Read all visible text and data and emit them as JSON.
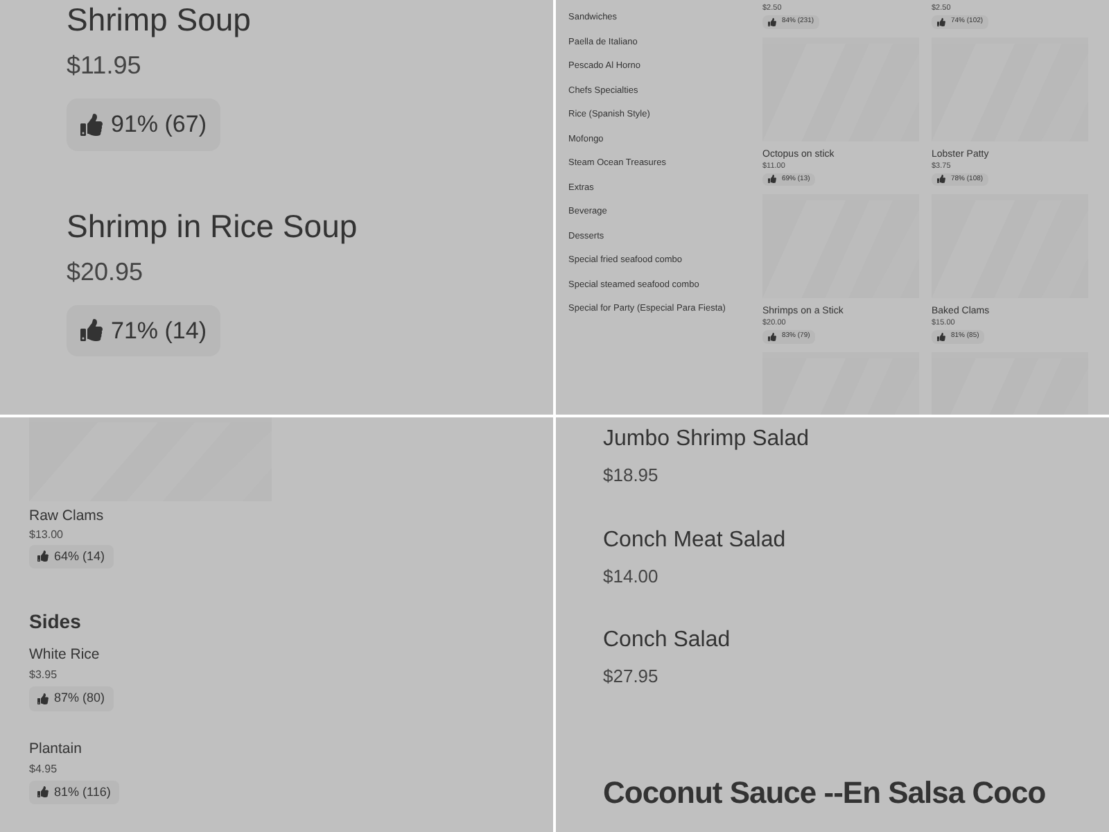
{
  "top_left": {
    "items": [
      {
        "name": "Shrimp Soup",
        "price": "$11.95",
        "rating": "91% (67)"
      },
      {
        "name": "Shrimp in Rice Soup",
        "price": "$20.95",
        "rating": "71% (14)"
      }
    ]
  },
  "top_right": {
    "categories": [
      "Sandwiches",
      "Paella de Italiano",
      "Pescado Al Horno",
      "Chefs Specialties",
      "Rice (Spanish Style)",
      "Mofongo",
      "Steam Ocean Treasures",
      "Extras",
      "Beverage",
      "Desserts",
      "Special fried seafood combo",
      "Special steamed seafood combo",
      "Special for Party (Especial Para Fiesta)"
    ],
    "cards": [
      {
        "price": "$2.50",
        "rating": "84% (231)"
      },
      {
        "price": "$2.50",
        "rating": "74% (102)"
      },
      {
        "kind": "picture",
        "name": "Octopus on stick",
        "price": "$11.00",
        "rating": "69% (13)"
      },
      {
        "kind": "picture",
        "name": "Lobster Patty",
        "price": "$3.75",
        "rating": "78% (108)"
      },
      {
        "kind": "picture",
        "name": "Shrimps on a Stick",
        "price": "$20.00",
        "rating": "83% (79)"
      },
      {
        "kind": "picture",
        "name": "Baked Clams",
        "price": "$15.00",
        "rating": "81% (85)"
      },
      {
        "kind": "picture"
      },
      {
        "kind": "picture"
      }
    ]
  },
  "bottom_left": {
    "first": {
      "kind": "picture",
      "name": "Raw Clams",
      "price": "$13.00",
      "rating": "64% (14)"
    },
    "section": "Sides",
    "items": [
      {
        "name": "White Rice",
        "price": "$3.95",
        "rating": "87% (80)"
      },
      {
        "name": "Plantain",
        "price": "$4.95",
        "rating": "81% (116)"
      }
    ]
  },
  "bottom_right": {
    "items": [
      {
        "name": "Jumbo Shrimp Salad",
        "price": "$18.95"
      },
      {
        "name": "Conch Meat Salad",
        "price": "$14.00"
      },
      {
        "name": "Conch Salad",
        "price": "$27.95"
      }
    ],
    "section": "Coconut Sauce --En Salsa Coco"
  }
}
